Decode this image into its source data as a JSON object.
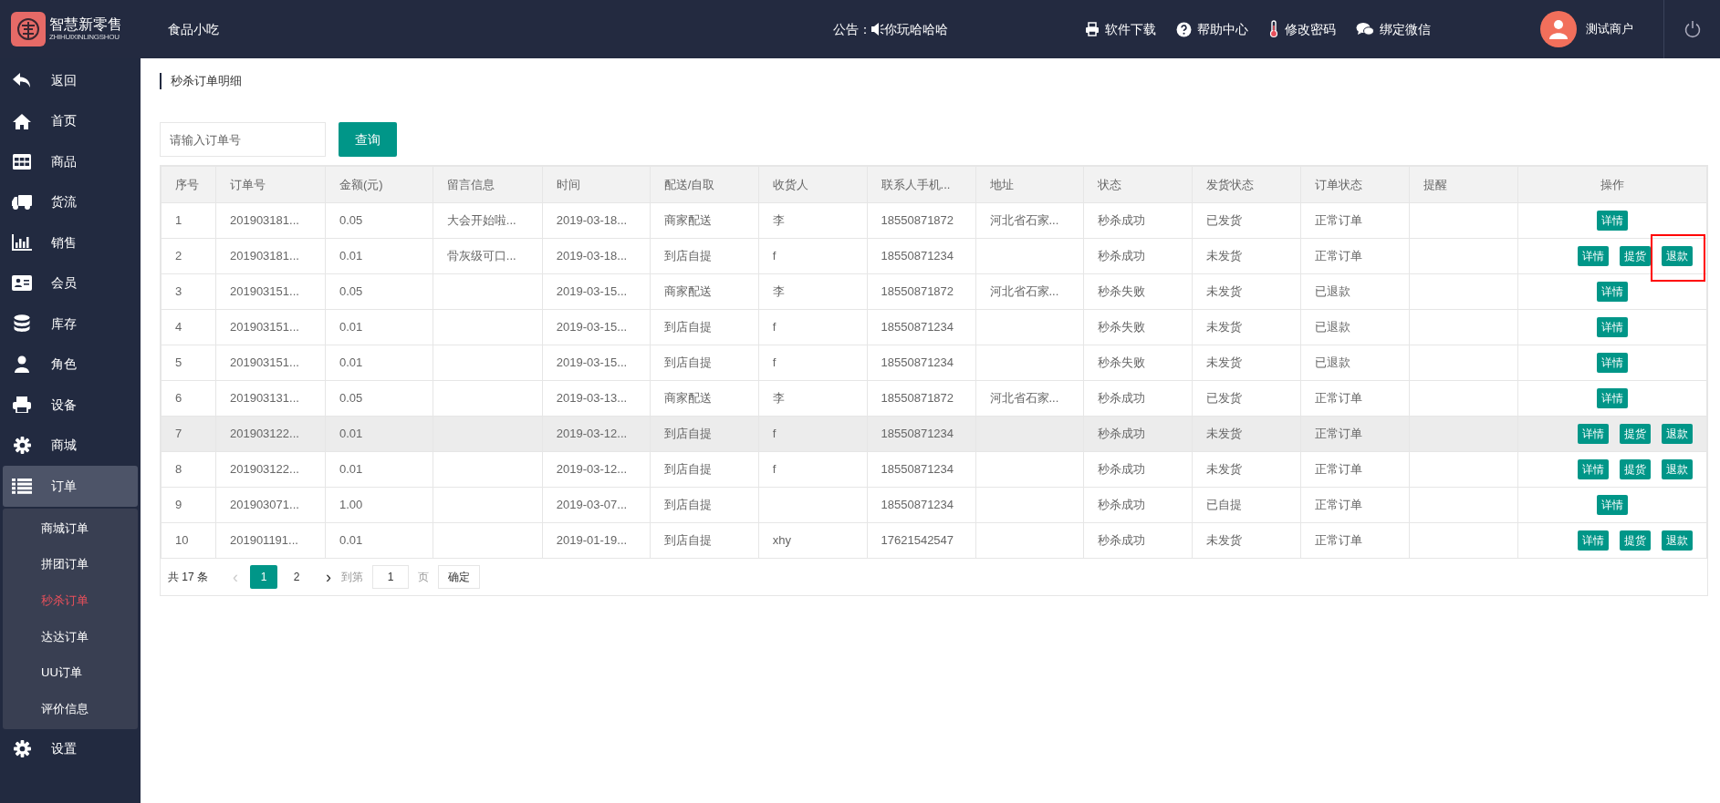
{
  "header": {
    "logo_title": "智慧新零售",
    "logo_subtitle": "ZHIHUIXINLINGSHOU",
    "store": "食品小吃",
    "notice_label": "公告：",
    "notice_text": "你玩哈哈哈",
    "links": [
      {
        "kind": "download",
        "label": "软件下载"
      },
      {
        "kind": "help",
        "label": "帮助中心"
      },
      {
        "kind": "password",
        "label": "修改密码"
      },
      {
        "kind": "wechat",
        "label": "绑定微信"
      }
    ],
    "user": "测试商户"
  },
  "sidebar": {
    "items": [
      {
        "kind": "back",
        "label": "返回",
        "selected": false
      },
      {
        "kind": "home",
        "label": "首页",
        "selected": false
      },
      {
        "kind": "grid",
        "label": "商品",
        "selected": false
      },
      {
        "kind": "truck",
        "label": "货流",
        "selected": false
      },
      {
        "kind": "chart",
        "label": "销售",
        "selected": false
      },
      {
        "kind": "card",
        "label": "会员",
        "selected": false
      },
      {
        "kind": "db",
        "label": "库存",
        "selected": false
      },
      {
        "kind": "user",
        "label": "角色",
        "selected": false
      },
      {
        "kind": "printer",
        "label": "设备",
        "selected": false
      },
      {
        "kind": "gear",
        "label": "商城",
        "selected": false
      },
      {
        "kind": "list",
        "label": "订单",
        "selected": true,
        "expanded": true,
        "children": [
          {
            "label": "商城订单",
            "selected": false
          },
          {
            "label": "拼团订单",
            "selected": false
          },
          {
            "label": "秒杀订单",
            "selected": true
          },
          {
            "label": "达达订单",
            "selected": false
          },
          {
            "label": "UU订单",
            "selected": false
          },
          {
            "label": "评价信息",
            "selected": false
          }
        ]
      },
      {
        "kind": "gear",
        "label": "设置",
        "selected": false
      }
    ]
  },
  "breadcrumb": "秒杀订单明细",
  "search": {
    "placeholder": "请输入订单号",
    "button": "查询"
  },
  "table": {
    "columns": [
      "序号",
      "订单号",
      "金额(元)",
      "留言信息",
      "时间",
      "配送/自取",
      "收货人",
      "联系人手机...",
      "地址",
      "状态",
      "发货状态",
      "订单状态",
      "提醒",
      "操作"
    ],
    "rows": [
      {
        "hovered": false,
        "cells": [
          "1",
          "201903181...",
          "0.05",
          "大会开始啦...",
          "2019-03-18...",
          "商家配送",
          "李",
          "18550871872",
          "河北省石家...",
          "秒杀成功",
          "已发货",
          "正常订单",
          ""
        ],
        "actions": [
          {
            "label": "详情",
            "highlighted": false
          }
        ]
      },
      {
        "hovered": false,
        "cells": [
          "2",
          "201903181...",
          "0.01",
          "骨灰级可口...",
          "2019-03-18...",
          "到店自提",
          "f",
          "18550871234",
          "",
          "秒杀成功",
          "未发货",
          "正常订单",
          ""
        ],
        "actions": [
          {
            "label": "详情",
            "highlighted": false
          },
          {
            "label": "提货",
            "highlighted": false
          },
          {
            "label": "退款",
            "highlighted": true
          }
        ]
      },
      {
        "hovered": false,
        "cells": [
          "3",
          "201903151...",
          "0.05",
          "",
          "2019-03-15...",
          "商家配送",
          "李",
          "18550871872",
          "河北省石家...",
          "秒杀失败",
          "未发货",
          "已退款",
          ""
        ],
        "actions": [
          {
            "label": "详情",
            "highlighted": false
          }
        ]
      },
      {
        "hovered": false,
        "cells": [
          "4",
          "201903151...",
          "0.01",
          "",
          "2019-03-15...",
          "到店自提",
          "f",
          "18550871234",
          "",
          "秒杀失败",
          "未发货",
          "已退款",
          ""
        ],
        "actions": [
          {
            "label": "详情",
            "highlighted": false
          }
        ]
      },
      {
        "hovered": false,
        "cells": [
          "5",
          "201903151...",
          "0.01",
          "",
          "2019-03-15...",
          "到店自提",
          "f",
          "18550871234",
          "",
          "秒杀失败",
          "未发货",
          "已退款",
          ""
        ],
        "actions": [
          {
            "label": "详情",
            "highlighted": false
          }
        ]
      },
      {
        "hovered": false,
        "cells": [
          "6",
          "201903131...",
          "0.05",
          "",
          "2019-03-13...",
          "商家配送",
          "李",
          "18550871872",
          "河北省石家...",
          "秒杀成功",
          "已发货",
          "正常订单",
          ""
        ],
        "actions": [
          {
            "label": "详情",
            "highlighted": false
          }
        ]
      },
      {
        "hovered": true,
        "cells": [
          "7",
          "201903122...",
          "0.01",
          "",
          "2019-03-12...",
          "到店自提",
          "f",
          "18550871234",
          "",
          "秒杀成功",
          "未发货",
          "正常订单",
          ""
        ],
        "actions": [
          {
            "label": "详情",
            "highlighted": false
          },
          {
            "label": "提货",
            "highlighted": false
          },
          {
            "label": "退款",
            "highlighted": false
          }
        ]
      },
      {
        "hovered": false,
        "cells": [
          "8",
          "201903122...",
          "0.01",
          "",
          "2019-03-12...",
          "到店自提",
          "f",
          "18550871234",
          "",
          "秒杀成功",
          "未发货",
          "正常订单",
          ""
        ],
        "actions": [
          {
            "label": "详情",
            "highlighted": false
          },
          {
            "label": "提货",
            "highlighted": false
          },
          {
            "label": "退款",
            "highlighted": false
          }
        ]
      },
      {
        "hovered": false,
        "cells": [
          "9",
          "201903071...",
          "1.00",
          "",
          "2019-03-07...",
          "到店自提",
          "",
          "18550871234",
          "",
          "秒杀成功",
          "已自提",
          "正常订单",
          ""
        ],
        "actions": [
          {
            "label": "详情",
            "highlighted": false
          }
        ]
      },
      {
        "hovered": false,
        "cells": [
          "10",
          "201901191...",
          "0.01",
          "",
          "2019-01-19...",
          "到店自提",
          "xhy",
          "17621542547",
          "",
          "秒杀成功",
          "未发货",
          "正常订单",
          ""
        ],
        "actions": [
          {
            "label": "详情",
            "highlighted": false
          },
          {
            "label": "提货",
            "highlighted": false
          },
          {
            "label": "退款",
            "highlighted": false
          }
        ]
      }
    ]
  },
  "pagination": {
    "total": "共 17 条",
    "prev": "‹",
    "pages": [
      {
        "label": "1",
        "selected": true
      },
      {
        "label": "2",
        "selected": false
      }
    ],
    "next": "›",
    "goto_label": "到第",
    "goto_value": "1",
    "page_unit": "页",
    "confirm": "确定"
  }
}
